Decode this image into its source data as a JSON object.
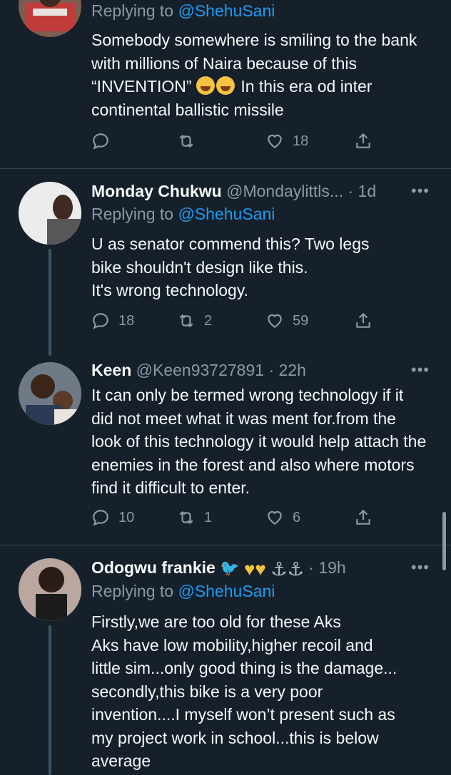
{
  "tweets": [
    {
      "reply_prefix": "Replying to ",
      "reply_handle": "@ShehuSani",
      "body_part1": "Somebody somewhere is smiling to the bank with millions of Naira because of this “INVENTION” ",
      "body_part2": " In this era od inter continental ballistic missile",
      "emoji": "face-with-tears-of-joy",
      "reply_count": "",
      "retweet_count": "",
      "like_count": "18"
    },
    {
      "name": "Monday Chukwu",
      "handle": "@Mondaylittls...",
      "time": "· 1d",
      "reply_prefix": "Replying to ",
      "reply_handle": "@ShehuSani",
      "lines": [
        "U as senator commend this? Two legs",
        "bike shouldn't design like this.",
        "It's wrong technology."
      ],
      "reply_count": "18",
      "retweet_count": "2",
      "like_count": "59"
    },
    {
      "name": "Keen",
      "handle": "@Keen93727891",
      "time": "· 22h",
      "body": "It can only be termed wrong technology if it did not meet what it was ment for.from the look of this technology it would help attach the enemies in the forest and also where motors find it difficult to enter.",
      "reply_count": "10",
      "retweet_count": "1",
      "like_count": "6"
    },
    {
      "name": "Odogwu frankie",
      "time": "· 19h",
      "reply_prefix": "Replying to ",
      "reply_handle": "@ShehuSani",
      "lines": [
        "Firstly,we are too old for these Aks",
        "Aks have low mobility,higher recoil and",
        "little sim...only good thing is the damage...",
        "secondly,this bike is a very poor",
        "invention....I myself won’t present such as",
        "my project work in school...this is below",
        "average"
      ]
    }
  ],
  "more_label": "•••",
  "icons": {
    "reply": "reply-icon",
    "retweet": "retweet-icon",
    "like": "heart-icon",
    "share": "share-icon",
    "bird": "bird-icon",
    "yellow_heart": "yellow-heart-emoji",
    "anchor": "anchor-emoji"
  },
  "colors": {
    "background": "#15202b",
    "text": "#f7f9f9",
    "muted": "#8b98a5",
    "link": "#1d9bf0",
    "divider": "#38444d"
  }
}
